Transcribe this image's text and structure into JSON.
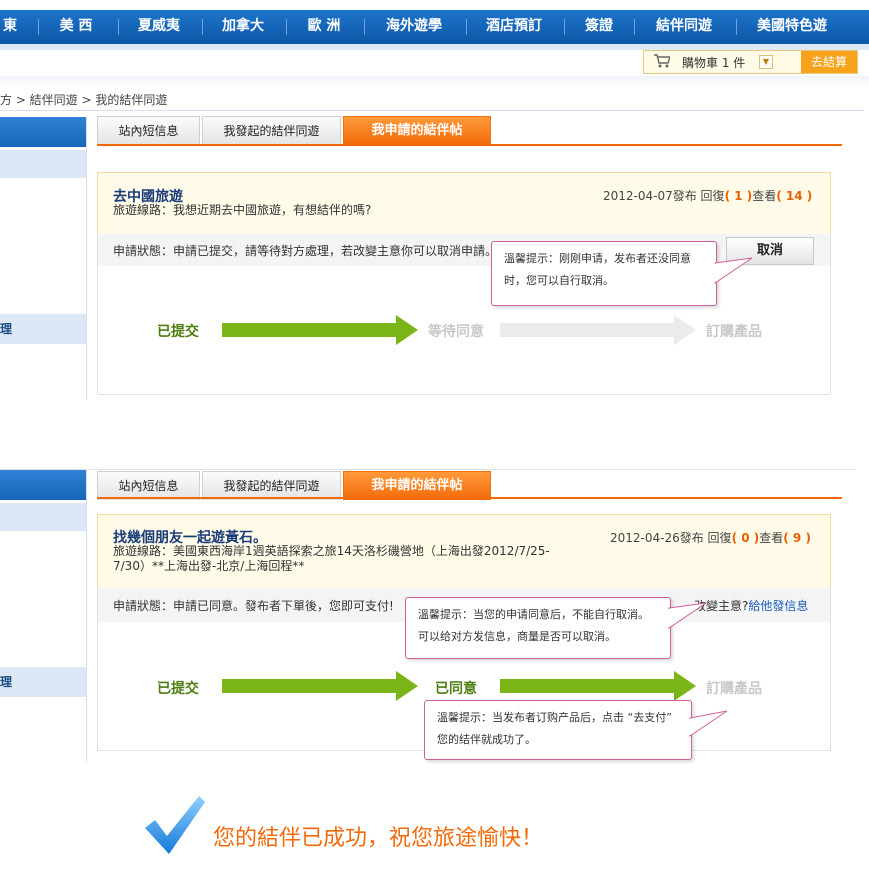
{
  "nav": {
    "items": [
      "東",
      "美 西",
      "夏威夷",
      "加拿大",
      "歐 洲",
      "海外遊學",
      "酒店預訂",
      "簽證",
      "結伴同遊",
      "美國特色遊"
    ]
  },
  "cart": {
    "label": "購物車 1 件",
    "checkout": "去結算"
  },
  "breadcrumb": "方 > 結伴同遊 > 我的結伴同遊",
  "sidebar": {
    "item_label": "理"
  },
  "tabs": [
    "站內短信息",
    "我發起的結伴同遊",
    "我申請的結伴帖"
  ],
  "posts": [
    {
      "title": "去中國旅遊",
      "route": "旅遊線路：我想近期去中國旅遊，有想結伴的嗎?",
      "meta_date": "2012-04-07發布  回復",
      "replies": "( 1 )",
      "views_label": "查看",
      "views": "( 14 )",
      "status": "申請狀態：申請已提交，請等待對方處理，若改變主意你可以取消申請。",
      "cancel": "取消",
      "tip": "溫馨提示：刚刚申请，发布者还没同意时，您可以自行取消。",
      "steps": [
        "已提交",
        "等待同意",
        "訂購產品"
      ]
    },
    {
      "title": "找幾個朋友一起遊黃石。",
      "route": "旅遊線路：美國東西海岸1週英語探索之旅14天洛杉磯營地（上海出發2012/7/25-7/30）**上海出發-北京/上海回程**",
      "meta_date": "2012-04-26發布  回復",
      "replies": "( 0 )",
      "views_label": "查看",
      "views": "( 9 )",
      "status": "申請狀態：申請已同意。發布者下單後，您即可支付!",
      "change_mind": "改變主意?",
      "message_link": "給他發信息",
      "tip": "溫馨提示：当您的申请同意后，不能自行取消。可以给对方发信息，商量是否可以取消。",
      "tip2": "溫馨提示：当发布者订购产品后，点击 “去支付” 您的结伴就成功了。",
      "steps": [
        "已提交",
        "已同意",
        "訂購產品"
      ]
    }
  ],
  "success_message": "您的結伴已成功，祝您旅途愉快！",
  "colors": {
    "nav_blue": "#1565b8",
    "accent_orange": "#f26a0a",
    "progress_green": "#7cb518",
    "progress_grey": "#e6e6e6"
  }
}
